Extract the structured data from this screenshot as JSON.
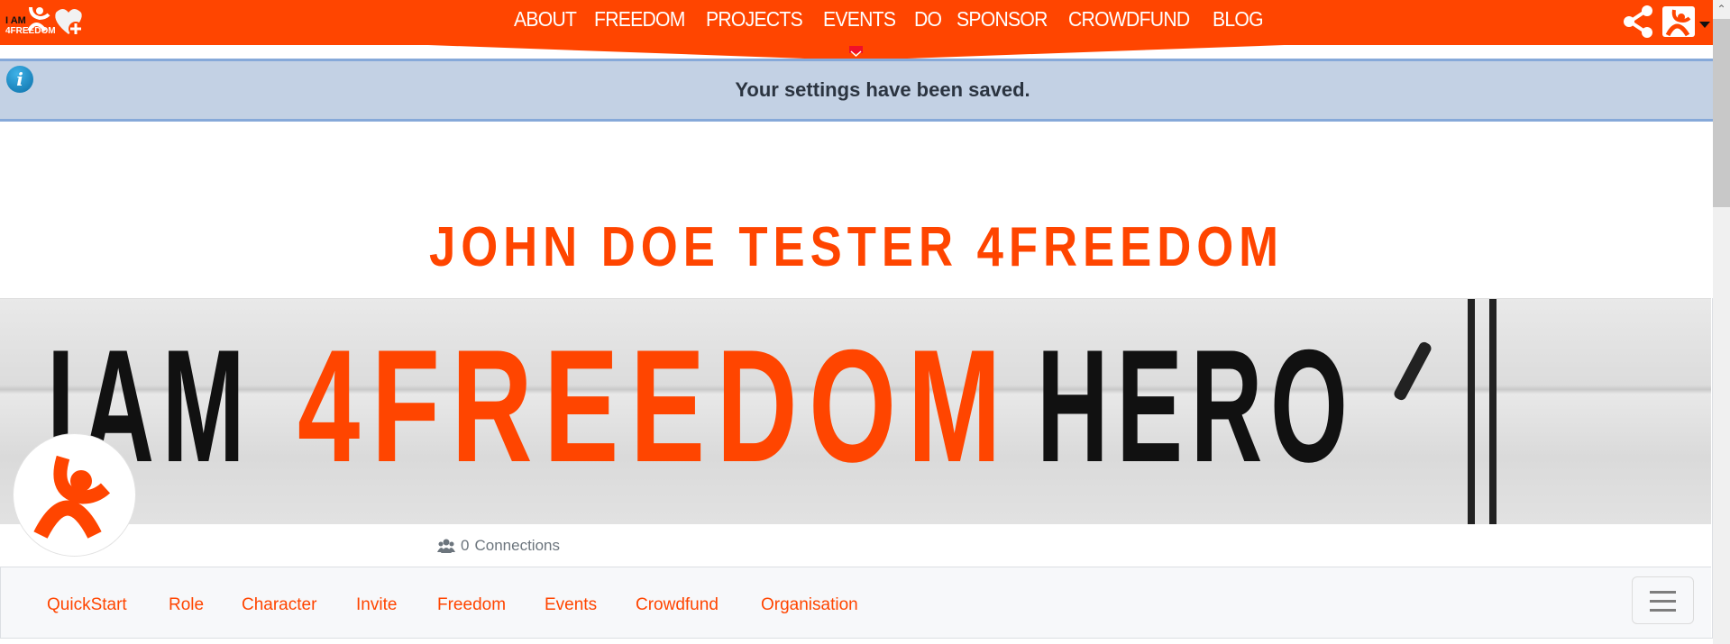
{
  "header": {
    "logo": {
      "line1": "I AM",
      "line2": "4FREEDOM"
    },
    "nav": [
      {
        "label": "ABOUT"
      },
      {
        "label": "FREEDOM"
      },
      {
        "label": "PROJECTS"
      },
      {
        "label": "EVENTS"
      },
      {
        "label": "DO"
      },
      {
        "label": "SPONSOR"
      },
      {
        "label": "CROWDFUND"
      },
      {
        "label": "BLOG"
      }
    ],
    "icons": {
      "share": "share-icon",
      "user": "user-avatar-icon",
      "caret": "caret-down-icon",
      "expand": "chevron-down-icon"
    },
    "brand_color": "#ff4500"
  },
  "alert": {
    "message": "Your settings have been saved.",
    "icon": "info-icon",
    "icon_glyph": "i",
    "background": "#c3d1e4"
  },
  "profile": {
    "title": "JOHN DOE TESTER 4FREEDOM",
    "cover": {
      "word1": "IAM",
      "word2": "4FREEDOM",
      "word3": "HERO"
    },
    "connections_count": "0",
    "connections_label": "Connections",
    "connections_icon": "users-icon"
  },
  "subnav": {
    "tabs": [
      {
        "label": "QuickStart"
      },
      {
        "label": "Role"
      },
      {
        "label": "Character"
      },
      {
        "label": "Invite"
      },
      {
        "label": "Freedom"
      },
      {
        "label": "Events"
      },
      {
        "label": "Crowdfund"
      },
      {
        "label": "Organisation"
      }
    ],
    "menu_icon": "hamburger-icon"
  }
}
